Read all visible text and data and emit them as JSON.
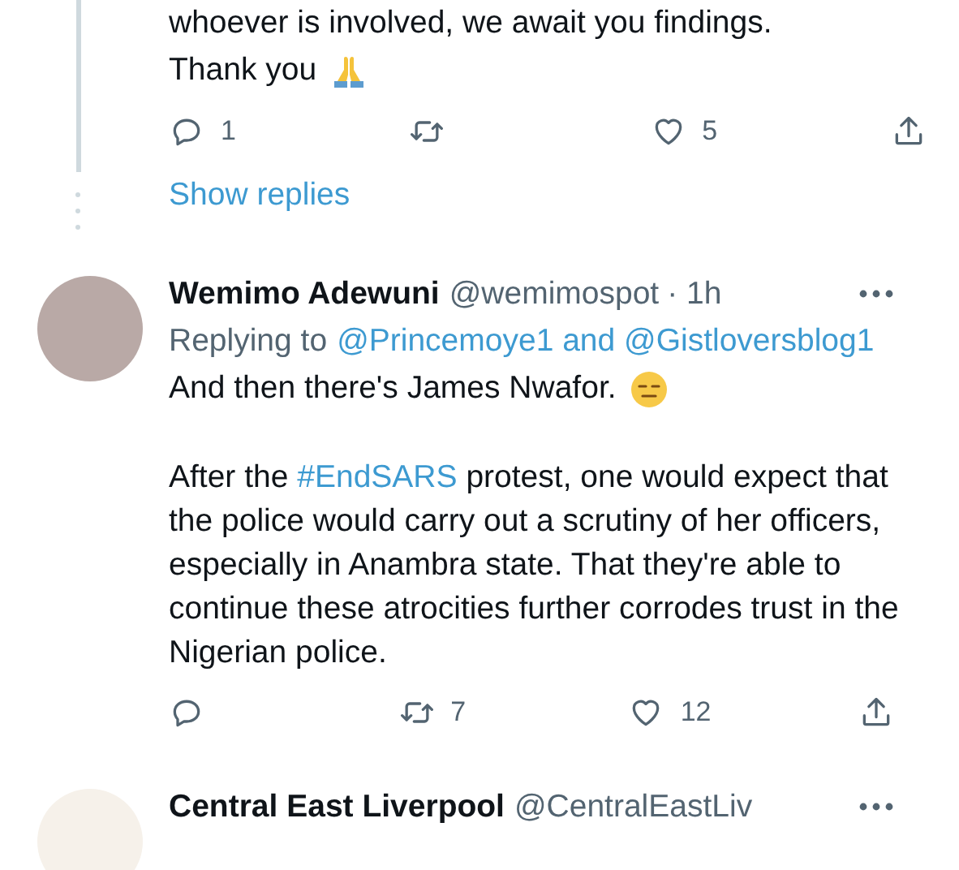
{
  "thread_tail": {
    "lines": [
      "whoever is involved, we await you findings.",
      "Thank you"
    ],
    "actions": [
      {
        "kind": "reply",
        "count": "1"
      },
      {
        "kind": "retweet"
      },
      {
        "kind": "like",
        "count": "5"
      },
      {
        "kind": "share"
      }
    ],
    "show_replies": "Show replies"
  },
  "reply": {
    "name": "Wemimo Adewuni",
    "handle": "@wemimospot",
    "time": "· 1h",
    "replying_label": "Replying to",
    "mentions": "@Princemoye1 and @Gistloversblog1",
    "first_line": "And then there's James Nwafor.",
    "paragraph": {
      "before": "After the ",
      "hashtag": "#EndSARS",
      "after": " protest, one would expect that the police would carry out a scrutiny of her officers, especially in Anambra state. That they're able to continue these atrocities further corrodes trust in the Nigerian police."
    },
    "actions": [
      {
        "kind": "reply"
      },
      {
        "kind": "retweet",
        "count": "7"
      },
      {
        "kind": "like",
        "count": "12"
      },
      {
        "kind": "share"
      }
    ]
  },
  "next": {
    "name": "Central East Liverpool",
    "handle": "@CentralEastLiv"
  }
}
